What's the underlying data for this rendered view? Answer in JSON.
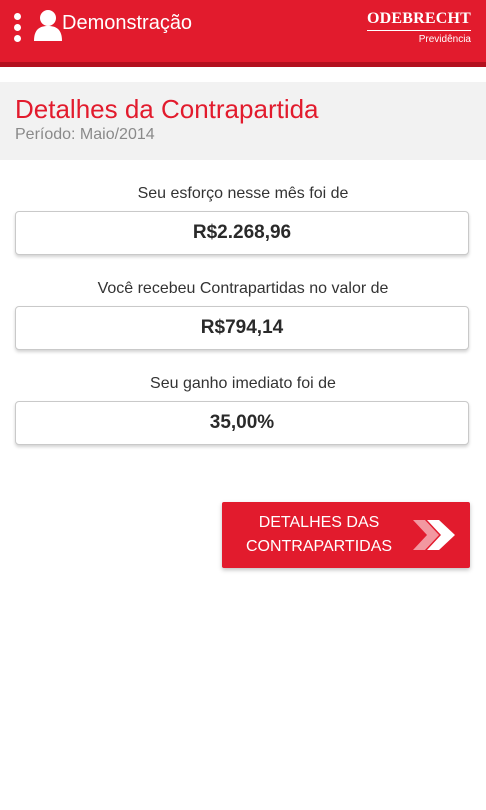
{
  "app_bar": {
    "title": "Demonstração",
    "menu_icon": "vertical-dots-icon",
    "user_icon": "user-icon",
    "brand": {
      "name": "ODEBRECHT",
      "subtitle": "Previdência"
    }
  },
  "header": {
    "title": "Detalhes da Contrapartida",
    "period": "Período: Maio/2014"
  },
  "sections": [
    {
      "label": "Seu esforço nesse mês foi de",
      "value": "R$2.268,96"
    },
    {
      "label": "Você recebeu Contrapartidas no valor de",
      "value": "R$794,14"
    },
    {
      "label": "Seu ganho imediato foi de",
      "value": "35,00%"
    }
  ],
  "details_button": {
    "line1": "DETALHES DAS",
    "line2": "CONTRAPARTIDAS",
    "icon": "double-chevron-right-icon"
  },
  "colors": {
    "brand_red": "#e21b2d",
    "brand_red_dark": "#b3101e",
    "header_bg": "#f2f2f2",
    "period_gray": "#8a8a8a"
  }
}
